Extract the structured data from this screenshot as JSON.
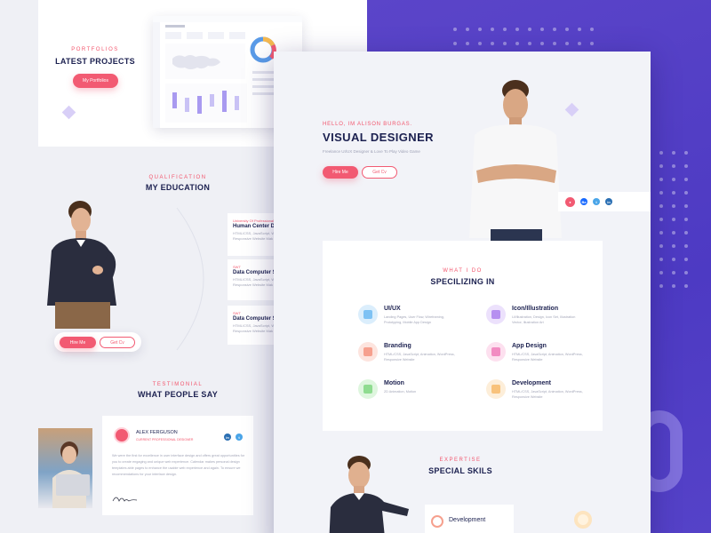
{
  "colors": {
    "accent_pink": "#f25a72",
    "navy": "#1c2150",
    "purple": "#5444c6"
  },
  "portfolio": {
    "eyebrow": "PORTFOLIOS",
    "title": "LATEST PROJECTS",
    "button": "My Portfolios"
  },
  "education": {
    "eyebrow": "QUALIFICATION",
    "title": "MY EDUCATION",
    "hire_button": "Hire Me",
    "contact_button": "Get Cv",
    "items": [
      {
        "eyebrow": "University Of Professional",
        "title": "Human Center D",
        "desc": "HTML/CSS, JavaScript, Wor\nResponsive Website Mak"
      },
      {
        "eyebrow": "SWT",
        "title": "Data Computer S",
        "desc": "HTML/CSS, JavaScript, Wor\nResponsive Website Mak"
      },
      {
        "eyebrow": "SWT",
        "title": "Data Computer S",
        "desc": "HTML/CSS, JavaScript, Wor\nResponsive Website Mak"
      }
    ]
  },
  "testimonial": {
    "eyebrow": "TESTIMONIAL",
    "title": "WHAT PEOPLE SAY",
    "name": "ALEX FERGUSON",
    "role": "CURRENT PROFESSIONAL DESIGNER",
    "quote": "We were the first for excellence in user interface design and offers great opportunities for you to create engaging and unique web experience. Calendar makes personal design templates able pages to enhance the usable web experience and again. To ensure we recommendations for your interface design."
  },
  "hero": {
    "hello": "HELLO, IM ALISON BURGAS.",
    "title": "VISUAL DESIGNER",
    "subtitle": "Freelance UI/UX Designer & Love To Play Video Game",
    "hire_button": "Hire Me",
    "cv_button": "Get Cv"
  },
  "services": {
    "eyebrow": "WHAT I DO",
    "title": "SPECILIZING IN",
    "items": [
      {
        "title": "UI/UX",
        "desc": "Landing Pages, User Flow, Wireframing, Prototyping, Mobile App Design",
        "icon": "ui-ux-icon",
        "color": "#7ec2f4"
      },
      {
        "title": "Icon/Illustration",
        "desc": "Ui/Illustration, Design, Icon Set, Illustration Vector, Illustration Art",
        "icon": "illustration-icon",
        "color": "#b68ff0"
      },
      {
        "title": "Branding",
        "desc": "HTML/CSS, JavaScript, Animation, WordPress, Responsive Website",
        "icon": "branding-icon",
        "color": "#f6a08e"
      },
      {
        "title": "App Design",
        "desc": "HTML/CSS, JavaScript, Animation, WordPress, Responsive Website",
        "icon": "app-design-icon",
        "color": "#f28cc2"
      },
      {
        "title": "Motion",
        "desc": "2D Animation, Motion",
        "icon": "motion-icon",
        "color": "#8fdc90"
      },
      {
        "title": "Development",
        "desc": "HTML/CSS, JavaScript, Animation, WordPress, Responsive Website",
        "icon": "development-icon",
        "color": "#f8c27b"
      }
    ]
  },
  "skills": {
    "eyebrow": "EXPERTISE",
    "title": "SPECIAL SKILS",
    "card_label": "Development"
  }
}
